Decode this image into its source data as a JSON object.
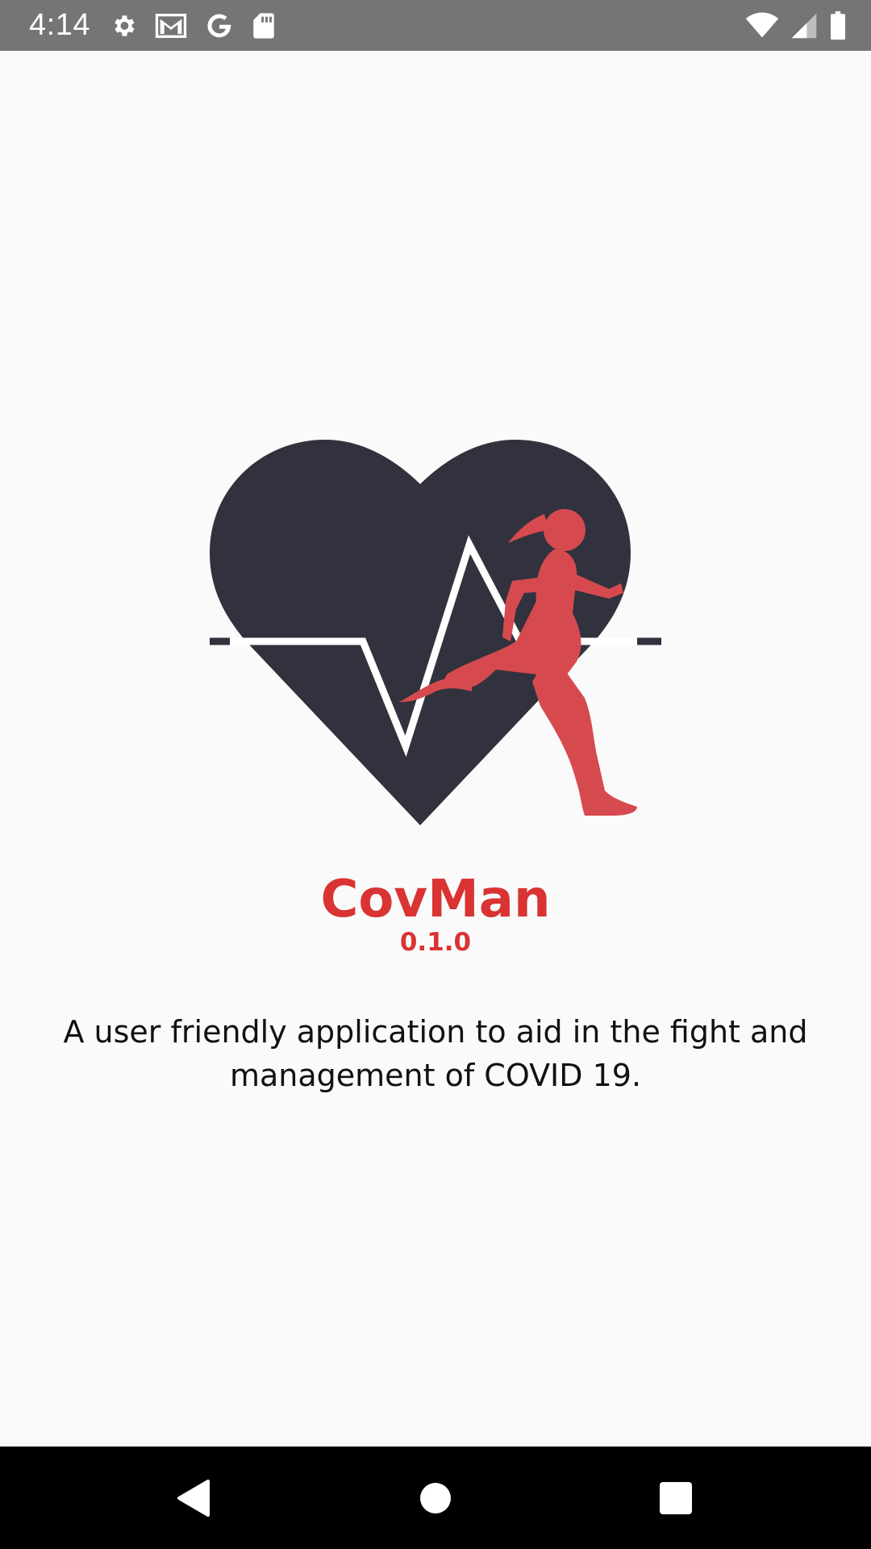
{
  "status_bar": {
    "time": "4:14",
    "left_icons": [
      "settings-icon",
      "gmail-icon",
      "google-icon",
      "sd-card-icon"
    ],
    "right_icons": [
      "wifi-icon",
      "cell-signal-icon",
      "battery-icon"
    ]
  },
  "splash": {
    "logo_icon": "heart-runner-logo",
    "app_name": "CovMan",
    "version": "0.1.0",
    "description": "A user friendly application to aid in the fight and management of COVID 19."
  },
  "nav_bar": {
    "buttons": [
      "back",
      "home",
      "recents"
    ]
  },
  "colors": {
    "accent": "#d93333",
    "heart": "#31323d",
    "runner": "#d64a4f",
    "status_bar": "#757575",
    "nav_bar": "#000000",
    "background": "#fafafa"
  }
}
